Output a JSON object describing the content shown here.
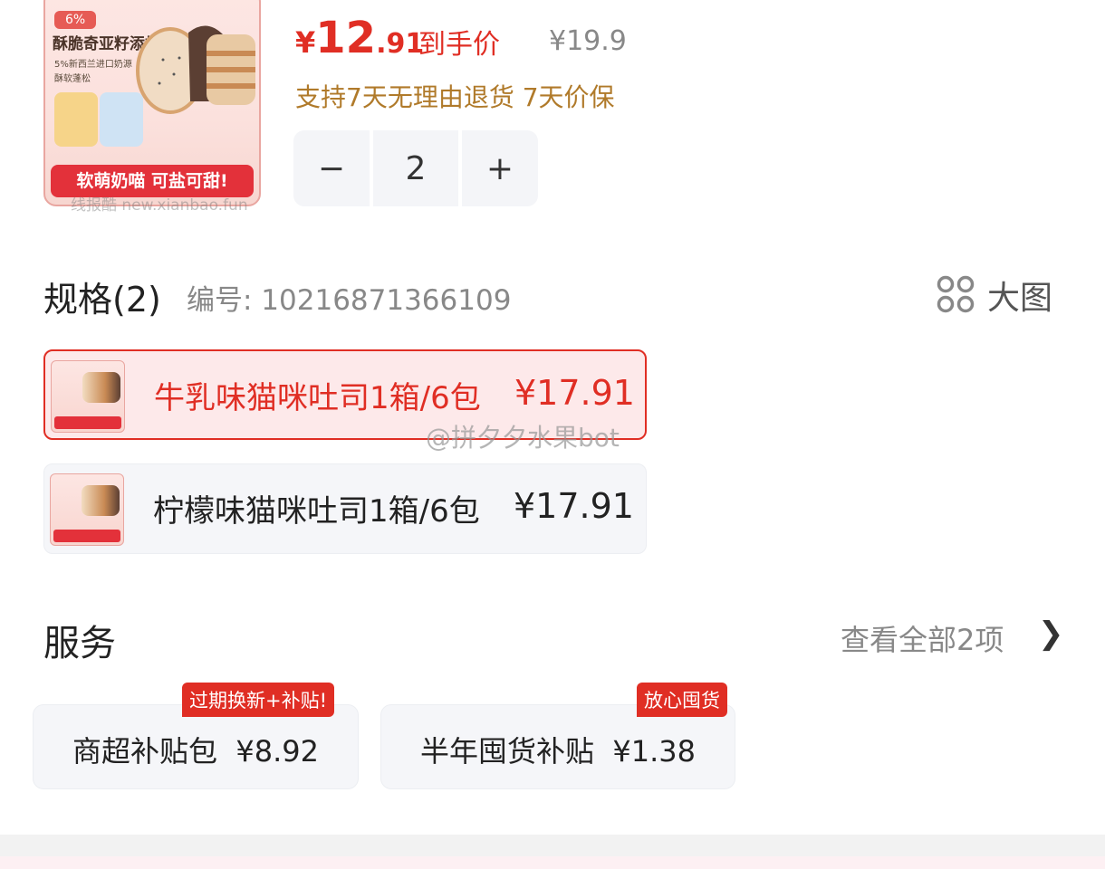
{
  "product": {
    "thumb": {
      "badge": "6%",
      "headline": "酥脆奇亚籽添加",
      "line1": "5%新西兰进口奶源",
      "line2": "酥软蓬松",
      "banner": "软萌奶喵 可盐可甜!",
      "watermark": "线报酷 new.xianbao.fun"
    },
    "price": {
      "currency": "¥",
      "integer": "12",
      "decimal": ".91",
      "label": "到手价"
    },
    "old_price": "¥19.9",
    "promise": "支持7天无理由退货 7天价保",
    "quantity": {
      "dec": "−",
      "value": "2",
      "inc": "+"
    }
  },
  "spec": {
    "title": "规格(2)",
    "code": "编号: 10216871366109",
    "big_picture": "大图",
    "options": [
      {
        "name": "牛乳味猫咪吐司1箱/6包",
        "price": "¥17.91",
        "selected": true
      },
      {
        "name": "柠檬味猫咪吐司1箱/6包",
        "price": "¥17.91",
        "selected": false
      }
    ]
  },
  "watermark": "@拼夕夕水果bot",
  "services": {
    "title": "服务",
    "view_all": "查看全部2项",
    "chevron": "❯",
    "items": [
      {
        "name": "商超补贴包",
        "price": "¥8.92",
        "badge": "过期换新+补贴!"
      },
      {
        "name": "半年囤货补贴",
        "price": "¥1.38",
        "badge": "放心囤货"
      }
    ]
  },
  "colors": {
    "accent": "#e02e24",
    "promise": "#b07a2a",
    "muted": "#888888",
    "card_bg": "#f5f6f9"
  }
}
